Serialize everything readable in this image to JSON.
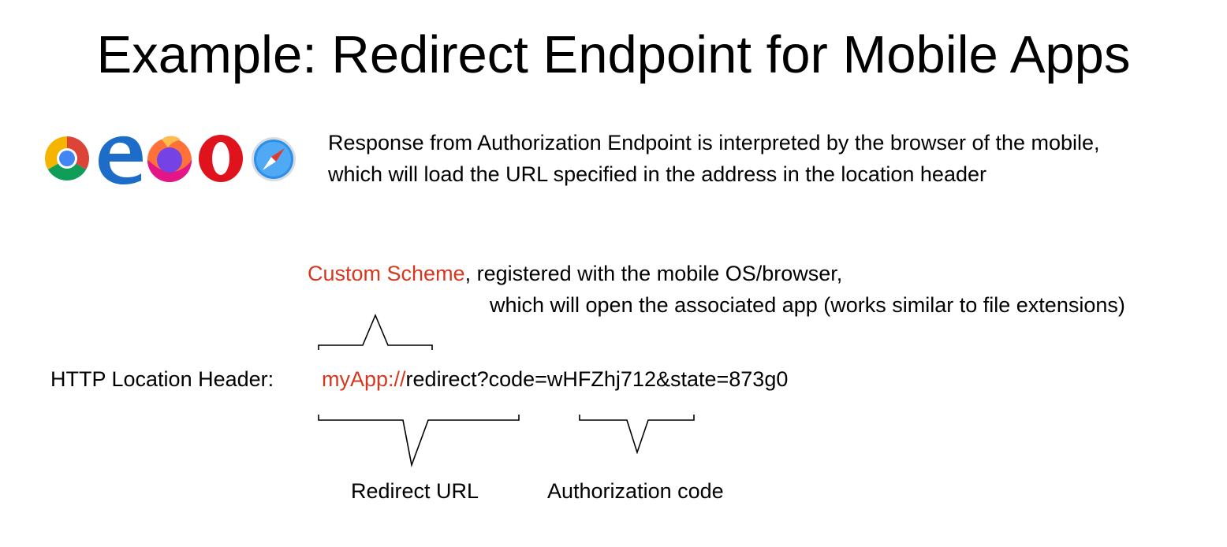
{
  "title": "Example: Redirect Endpoint for Mobile Apps",
  "browsers": [
    {
      "icon": "chrome-icon"
    },
    {
      "icon": "edge-icon"
    },
    {
      "icon": "firefox-icon"
    },
    {
      "icon": "opera-icon"
    },
    {
      "icon": "safari-icon"
    }
  ],
  "description": {
    "line1": "Response from Authorization Endpoint is interpreted by the browser of the mobile,",
    "line2": "which will load the URL specified in the address in the location header"
  },
  "scheme_note": {
    "highlight": "Custom Scheme",
    "line1_rest": ", registered with the mobile OS/browser,",
    "line2": "which will open the associated app (works similar to file extensions)"
  },
  "location_header": {
    "label": "HTTP Location Header:",
    "scheme": "myApp://",
    "rest": "redirect?code=wHFZhj712&state=873g0"
  },
  "annotations": {
    "redirect_url": "Redirect URL",
    "authorization_code": "Authorization code"
  },
  "colors": {
    "highlight": "#d6371f",
    "text": "#000000"
  }
}
